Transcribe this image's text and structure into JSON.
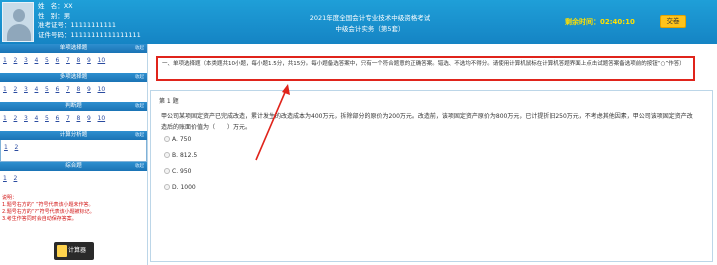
{
  "candidate": {
    "rows": [
      {
        "label": "姓",
        "sep": "名：",
        "value": "XX"
      },
      {
        "label": "性",
        "sep": "别：",
        "value": "男"
      },
      {
        "label": "准考证号：",
        "sep": "",
        "value": "11111111111"
      },
      {
        "label": "证件号码：",
        "sep": "",
        "value": "11111111111111111"
      }
    ]
  },
  "header": {
    "title_line1": "2021年度全国会计专业技术中级资格考试",
    "title_line2": "中级会计实务（第5套）",
    "timer_label": "剩余时间：",
    "timer_value": "02:40:10",
    "submit_label": "交卷"
  },
  "sidebar": {
    "fold_label": "收起",
    "sections": [
      {
        "title": "单项选择题",
        "items": [
          "1",
          "2",
          "3",
          "4",
          "5",
          "6",
          "7",
          "8",
          "9",
          "10"
        ]
      },
      {
        "title": "多项选择题",
        "items": [
          "1",
          "2",
          "3",
          "4",
          "5",
          "6",
          "7",
          "8",
          "9",
          "10"
        ]
      },
      {
        "title": "判断题",
        "items": [
          "1",
          "2",
          "3",
          "4",
          "5",
          "6",
          "7",
          "8",
          "9",
          "10"
        ]
      },
      {
        "title": "计算分析题",
        "items": [
          "1",
          "2"
        ]
      },
      {
        "title": "综合题",
        "items": [
          "1",
          "2"
        ]
      }
    ],
    "notes": [
      "说明：",
      "1.题号右方的“ ”符号代表该小题未作答。",
      "2.题号右方的“?”符号代表该小题被标记。",
      "3.考生作答同时会自动保存答案。"
    ],
    "calculator_label": "计算器"
  },
  "main": {
    "instruction": "一、单项选择题（本类题共10小题，每小题1.5分，共15分。每小题备选答案中，只有一个符合题意的正确答案。错选、不选均不得分。请使用计算机鼠标在计算机答题界面上点击试题答案备选项前的按钮“○”作答）",
    "question_no": "第 1 题",
    "question_text": "甲公司某项固定资产已完成改造，累计发生的改造成本为400万元，拆除部分的原价为200万元。改造前，该项固定资产原价为800万元，已计提折旧250万元，不考虑其他因素，甲公司该项固定资产改造后的账面价值为（　　）万元。",
    "options": [
      {
        "letter": "A.",
        "text": "750"
      },
      {
        "letter": "B.",
        "text": "812.5"
      },
      {
        "letter": "C.",
        "text": "950"
      },
      {
        "letter": "D.",
        "text": "1000"
      }
    ]
  },
  "colors": {
    "header": "#1a8fd0",
    "highlight": "#e0241b",
    "timer": "#ffe000",
    "submit": "#ffc31a"
  }
}
